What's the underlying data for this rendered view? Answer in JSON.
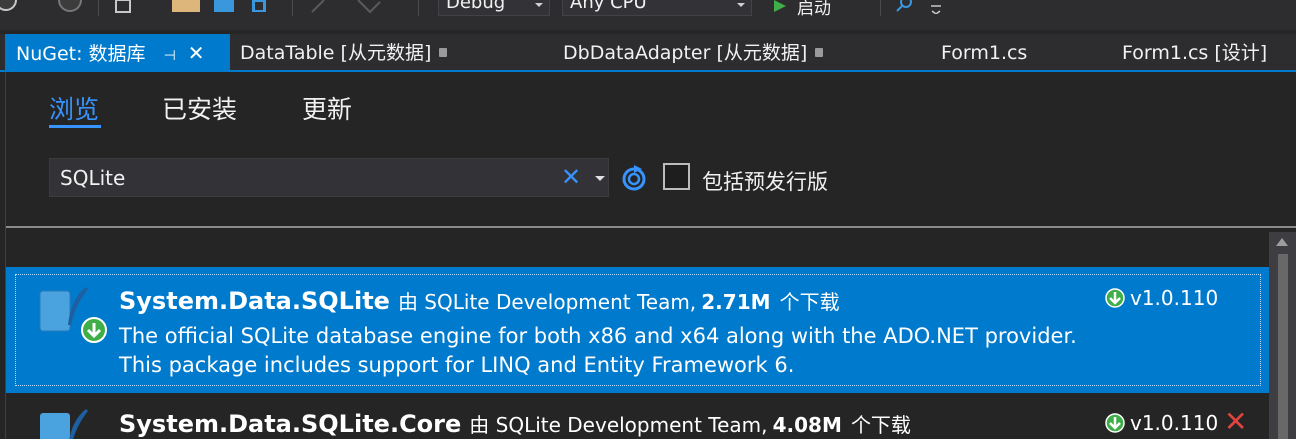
{
  "toolbar": {
    "config": "Debug",
    "platform": "Any CPU",
    "start_label": "启动"
  },
  "tabs": [
    {
      "label": "NuGet: 数据库",
      "active": true
    },
    {
      "label": "DataTable [从元数据]",
      "locked": true
    },
    {
      "label": "DbDataAdapter [从元数据]",
      "locked": true
    },
    {
      "label": "Form1.cs"
    },
    {
      "label": "Form1.cs [设计]"
    }
  ],
  "subtabs": [
    "浏览",
    "已安装",
    "更新"
  ],
  "search": {
    "value": "SQLite",
    "clear_icon": "close-icon"
  },
  "prerelease_label": "包括预发行版",
  "packages": [
    {
      "name": "System.Data.SQLite",
      "by": "由 SQLite Development Team,",
      "downloads": "2.71M",
      "downloads_suffix": "个下载",
      "desc_line1": "The official SQLite database engine for both x86 and x64 along with the ADO.NET provider.",
      "desc_line2": "This package includes support for LINQ and Entity Framework 6.",
      "version": "v1.0.110",
      "selected": true
    },
    {
      "name": "System.Data.SQLite.Core",
      "by": "由 SQLite Development Team,",
      "downloads": "4.08M",
      "downloads_suffix": "个下载",
      "version": "v1.0.110",
      "uninstall_icon": "✕"
    }
  ],
  "colors": {
    "accent": "#007acc",
    "link": "#3794ff",
    "background": "#252526",
    "download": "#3fae49"
  }
}
